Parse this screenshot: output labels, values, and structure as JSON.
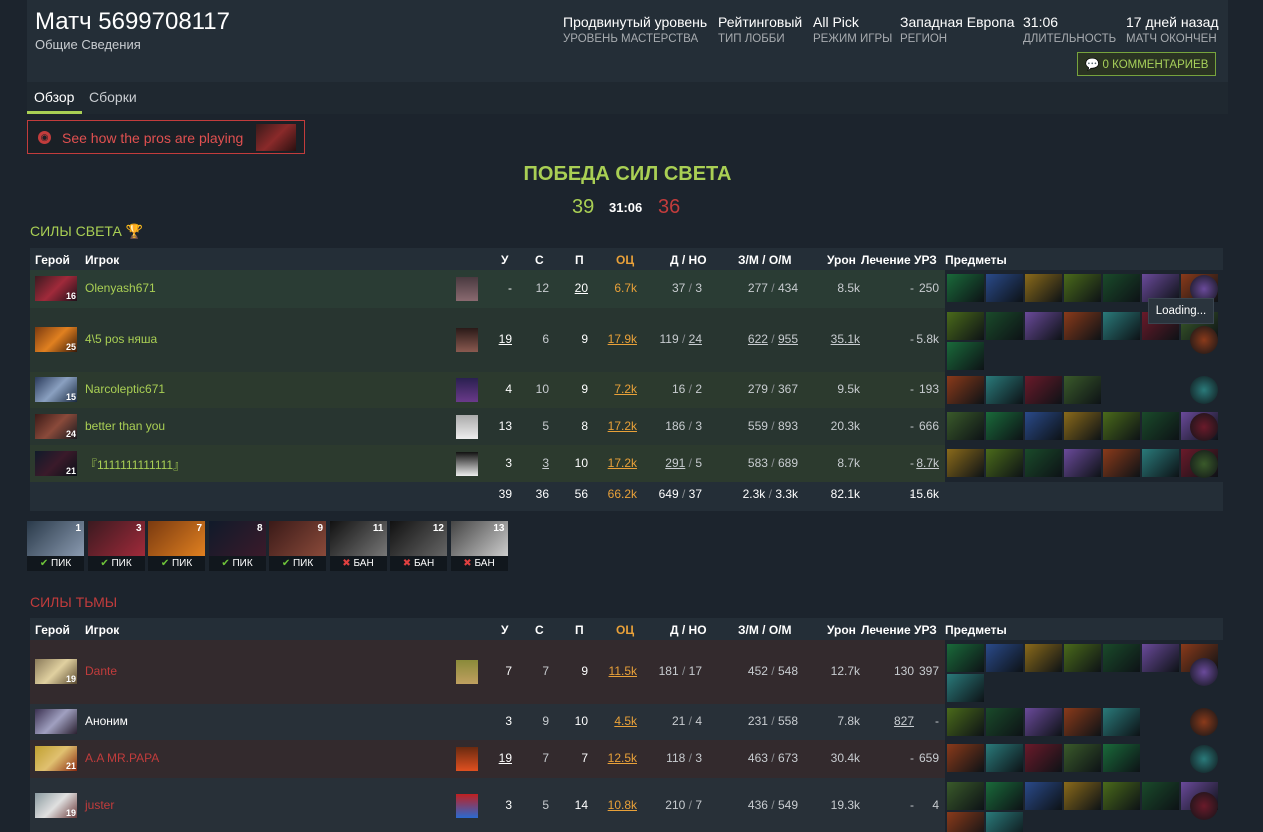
{
  "match": {
    "title": "Матч 5699708117",
    "subtitle": "Общие Сведения",
    "meta": [
      {
        "value": "Продвинутый уровень",
        "label": "УРОВЕНЬ МАСТЕРСТВА"
      },
      {
        "value": "Рейтинговый",
        "label": "ТИП ЛОББИ"
      },
      {
        "value": "All Pick",
        "label": "РЕЖИМ ИГРЫ"
      },
      {
        "value": "Западная Европа",
        "label": "РЕГИОН"
      },
      {
        "value": "31:06",
        "label": "ДЛИТЕЛЬНОСТЬ"
      },
      {
        "value": "17 дней назад",
        "label": "МАТЧ ОКОНЧЕН"
      }
    ],
    "comments_label": "0 КОММЕНТАРИЕВ"
  },
  "tabs": [
    {
      "label": "Обзор"
    },
    {
      "label": "Сборки"
    }
  ],
  "promo": {
    "text": "See how the pros are playing"
  },
  "result": {
    "winner": "ПОБЕДА СИЛ СВЕТА",
    "radiant_score": "39",
    "duration": "31:06",
    "dire_score": "36"
  },
  "columns": {
    "hero": "Герой",
    "player": "Игрок",
    "k": "У",
    "d": "С",
    "a": "П",
    "nw": "ОЦ",
    "lhdn": "Д / НО",
    "gpmxpm": "З/М / О/М",
    "dmg": "Урон",
    "heal": "Лечение",
    "bld": "УРЗ",
    "items": "Предметы"
  },
  "radiant": {
    "title": "СИЛЫ СВЕТА",
    "players": [
      {
        "level": "16",
        "name": "Olenyash671",
        "k": "-",
        "d": "12",
        "a": "20",
        "nw": "6.7k",
        "lh": "37",
        "dn": "3",
        "gpm": "277",
        "xpm": "434",
        "dmg": "8.5k",
        "heal": "-",
        "bld": "250"
      },
      {
        "level": "25",
        "name": "4\\5 pos няша",
        "k": "19",
        "d": "6",
        "a": "9",
        "nw": "17.9k",
        "lh": "119",
        "dn": "24",
        "gpm": "622",
        "xpm": "955",
        "dmg": "35.1k",
        "heal": "-",
        "bld": "5.8k"
      },
      {
        "level": "15",
        "name": "Narcoleptic671",
        "k": "4",
        "d": "10",
        "a": "9",
        "nw": "7.2k",
        "lh": "16",
        "dn": "2",
        "gpm": "279",
        "xpm": "367",
        "dmg": "9.5k",
        "heal": "-",
        "bld": "193"
      },
      {
        "level": "24",
        "name": "better than you",
        "k": "13",
        "d": "5",
        "a": "8",
        "nw": "17.2k",
        "lh": "186",
        "dn": "3",
        "gpm": "559",
        "xpm": "893",
        "dmg": "20.3k",
        "heal": "-",
        "bld": "666"
      },
      {
        "level": "21",
        "name": "『1111111111111』",
        "k": "3",
        "d": "3",
        "a": "10",
        "nw": "17.2k",
        "lh": "291",
        "dn": "5",
        "gpm": "583",
        "xpm": "689",
        "dmg": "8.7k",
        "heal": "-",
        "bld": "8.7k"
      }
    ],
    "totals": {
      "k": "39",
      "d": "36",
      "a": "56",
      "nw": "66.2k",
      "lh": "649",
      "dn": "37",
      "gpm": "2.3k",
      "xpm": "3.3k",
      "dmg": "82.1k",
      "heal": "-",
      "bld": "15.6k"
    }
  },
  "picks": [
    {
      "n": "1",
      "label": "ПИК"
    },
    {
      "n": "3",
      "label": "ПИК"
    },
    {
      "n": "7",
      "label": "ПИК"
    },
    {
      "n": "8",
      "label": "ПИК"
    },
    {
      "n": "9",
      "label": "ПИК"
    },
    {
      "n": "11",
      "label": "БАН"
    },
    {
      "n": "12",
      "label": "БАН"
    },
    {
      "n": "13",
      "label": "БАН"
    }
  ],
  "loading_tooltip": "Loading...",
  "dire": {
    "title": "СИЛЫ ТЬМЫ",
    "players": [
      {
        "level": "19",
        "name": "Dante",
        "k": "7",
        "d": "7",
        "a": "9",
        "nw": "11.5k",
        "lh": "181",
        "dn": "17",
        "gpm": "452",
        "xpm": "548",
        "dmg": "12.7k",
        "heal": "130",
        "bld": "397"
      },
      {
        "level": "",
        "name": "Аноним",
        "k": "3",
        "d": "9",
        "a": "10",
        "nw": "4.5k",
        "lh": "21",
        "dn": "4",
        "gpm": "231",
        "xpm": "558",
        "dmg": "7.8k",
        "heal": "827",
        "bld": "-"
      },
      {
        "level": "21",
        "name": "A.A MR.PAPA",
        "k": "19",
        "d": "7",
        "a": "7",
        "nw": "12.5k",
        "lh": "118",
        "dn": "3",
        "gpm": "463",
        "xpm": "673",
        "dmg": "30.4k",
        "heal": "-",
        "bld": "659"
      },
      {
        "level": "19",
        "name": "juster",
        "k": "3",
        "d": "5",
        "a": "14",
        "nw": "10.8k",
        "lh": "210",
        "dn": "7",
        "gpm": "436",
        "xpm": "549",
        "dmg": "19.3k",
        "heal": "-",
        "bld": "4"
      }
    ]
  }
}
